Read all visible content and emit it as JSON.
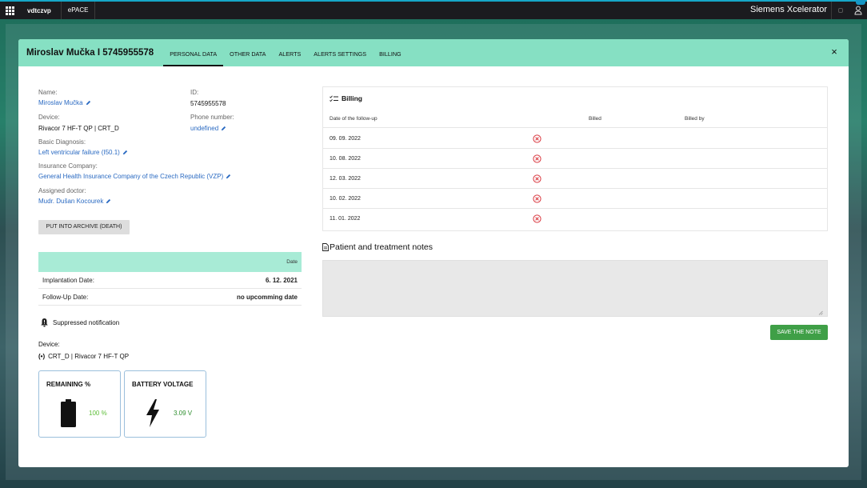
{
  "topbar": {
    "app_name": "vdtczvp",
    "module": "ePACE",
    "brand": "Siemens Xcelerator"
  },
  "modal": {
    "title": "Miroslav Mučka I 5745955578",
    "tabs": [
      {
        "label": "PERSONAL DATA"
      },
      {
        "label": "OTHER DATA"
      },
      {
        "label": "ALERTS"
      },
      {
        "label": "ALERTS SETTINGS"
      },
      {
        "label": "BILLING"
      }
    ],
    "close_label": "×"
  },
  "personal": {
    "name_label": "Name:",
    "name_value": "Miroslav Mučka",
    "id_label": "ID:",
    "id_value": "5745955578",
    "device_label": "Device:",
    "device_value": "Rivacor 7 HF-T QP | CRT_D",
    "phone_label": "Phone number:",
    "phone_value": "undefined",
    "diagnosis_label": "Basic Diagnosis:",
    "diagnosis_value": "Left ventricular failure (I50.1)",
    "insurance_label": "Insurance Company:",
    "insurance_value": "General Health Insurance Company of the Czech Republic (VZP)",
    "doctor_label": "Assigned doctor:",
    "doctor_value": "Mudr. Dušan Kocourek",
    "archive_button": "PUT INTO ARCHIVE (DEATH)"
  },
  "dates": {
    "header": "Date",
    "rows": [
      {
        "label": "Implantation Date:",
        "value": "6. 12. 2021"
      },
      {
        "label": "Follow-Up Date:",
        "value": "no upcomming date"
      }
    ]
  },
  "suppressed_text": "Suppressed notification",
  "device_section": {
    "label": "Device:",
    "value": "CRT_D | Rivacor 7 HF-T QP"
  },
  "cards": {
    "remaining": {
      "title": "REMAINING %",
      "value": "100 %",
      "color": "#5fbf3a"
    },
    "voltage": {
      "title": "BATTERY VOLTAGE",
      "value": "3.09 V",
      "color": "#2f8f2f"
    }
  },
  "billing": {
    "title": "Billing",
    "columns": [
      "Date of the follow-up",
      "Billed",
      "Billed by"
    ],
    "rows": [
      {
        "date": "09. 09. 2022"
      },
      {
        "date": "10. 08. 2022"
      },
      {
        "date": "12. 03. 2022"
      },
      {
        "date": "10. 02. 2022"
      },
      {
        "date": "11. 01. 2022"
      }
    ]
  },
  "notes": {
    "title": "Patient and treatment notes",
    "value": "",
    "save_button": "SAVE THE NOTE"
  },
  "colors": {
    "header_bg": "#86e0c3",
    "link": "#2a6ac2",
    "save": "#3f9f47",
    "error": "#d9363e"
  }
}
